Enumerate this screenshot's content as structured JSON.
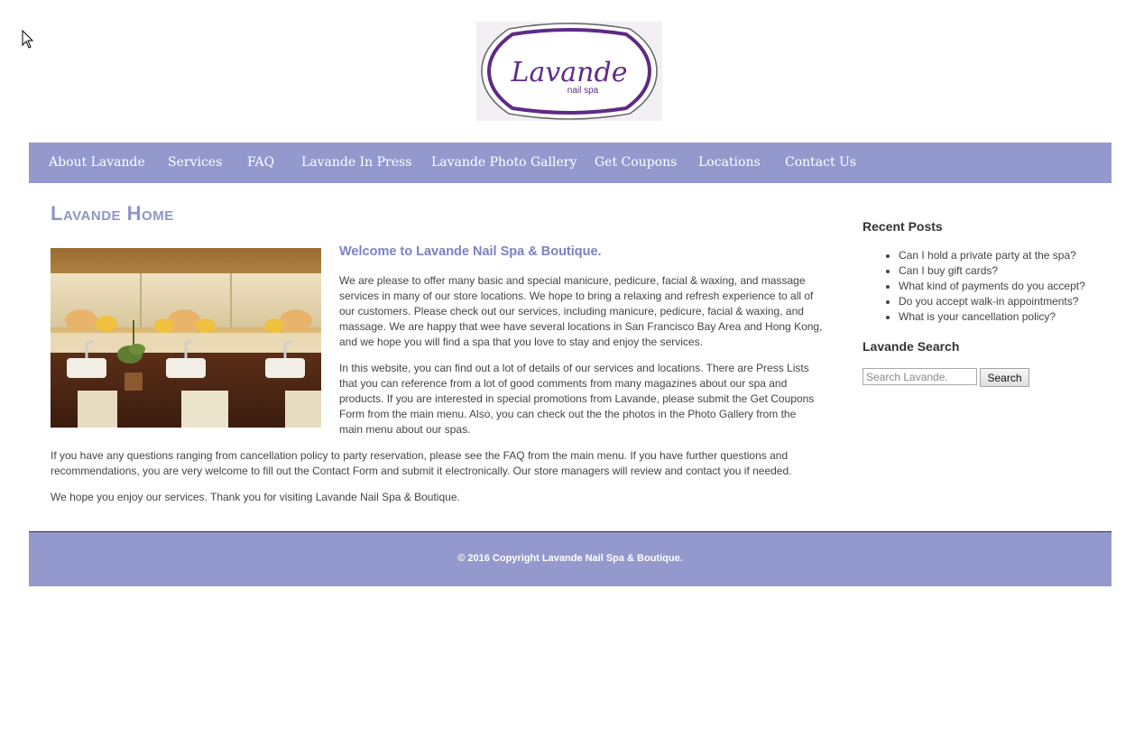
{
  "brand": {
    "logo_text": "Lavande",
    "logo_subtext": "nail spa",
    "accent_color": "#9399cc",
    "logo_purple": "#5e2a86"
  },
  "nav": {
    "items": [
      {
        "label": "About Lavande"
      },
      {
        "label": "Services"
      },
      {
        "label": "FAQ"
      },
      {
        "label": "Lavande In Press"
      },
      {
        "label": "Lavande Photo Gallery"
      },
      {
        "label": "Get Coupons"
      },
      {
        "label": "Locations"
      },
      {
        "label": "Contact Us"
      }
    ]
  },
  "main": {
    "page_title": "Lavande Home",
    "welcome_heading": "Welcome to Lavande Nail Spa & Boutique.",
    "paragraphs": [
      "We are please to offer many basic and special manicure, pedicure, facial & waxing, and massage services in many of our store locations. We hope to bring a relaxing and refresh experience to all of our customers. Please check out our services, including manicure, pedicure, facial & waxing, and massage. We are happy that wee have several locations in San Francisco Bay Area and Hong Kong, and we hope you will find a spa that you love to stay and enjoy the services.",
      "In this website, you can find out a lot of details of our services and locations. There are Press Lists that you can reference from a lot of good comments from many magazines about our spa and products. If you are interested in special promotions from Lavande, please submit the Get Coupons Form from the main menu. Also, you can check out the the photos in the Photo Gallery from the main menu about our spas.",
      "If you have any questions ranging from cancellation policy to party reservation, please see the FAQ from the main menu. If you have further questions and recommendations, you are very welcome to fill out the Contact Form and submit it electronically. Our store managers will review and contact you if needed.",
      "We hope you enjoy our services. Thank you for visiting Lavande Nail Spa & Boutique."
    ]
  },
  "sidebar": {
    "recent_posts_title": "Recent Posts",
    "recent_posts": [
      "Can I hold a private party at the spa?",
      "Can I buy gift cards?",
      "What kind of payments do you accept?",
      "Do you accept walk-in appointments?",
      "What is your cancellation policy?"
    ],
    "search_title": "Lavande Search",
    "search_placeholder": "Search Lavande.",
    "search_button": "Search"
  },
  "footer": {
    "copyright": "© 2016 Copyright Lavande Nail Spa & Boutique."
  }
}
